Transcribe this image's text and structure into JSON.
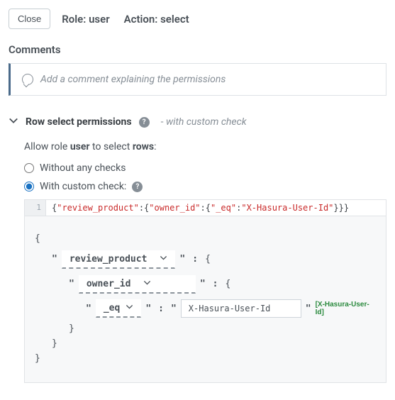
{
  "header": {
    "close_label": "Close",
    "role_label": "Role:",
    "role_value": "user",
    "action_label": "Action:",
    "action_value": "select"
  },
  "comments": {
    "title": "Comments",
    "placeholder": "Add a comment explaining the permissions"
  },
  "permissions": {
    "title": "Row select permissions",
    "subtitle_prefix": "-",
    "subtitle": "with custom check",
    "allow_pre": "Allow role",
    "allow_role": "user",
    "allow_mid": "to select",
    "allow_obj": "rows",
    "allow_post": ":",
    "option_without": "Without any checks",
    "option_with": "With custom check:",
    "selected": "with"
  },
  "code": {
    "line_num": "1",
    "raw": {
      "p1": "{",
      "k1": "\"review_product\"",
      "p2": ":{",
      "k2": "\"owner_id\"",
      "p3": ":{",
      "k3": "\"_eq\"",
      "p4": ":",
      "v1": "\"X-Hasura-User-Id\"",
      "p5": "}}}"
    }
  },
  "builder": {
    "field1": "review_product",
    "field2": "owner_id",
    "op": "_eq",
    "value": "X-Hasura-User-Id",
    "chip": "[X-Hasura-User-Id]",
    "brace_open": "{",
    "brace_close": "}"
  }
}
